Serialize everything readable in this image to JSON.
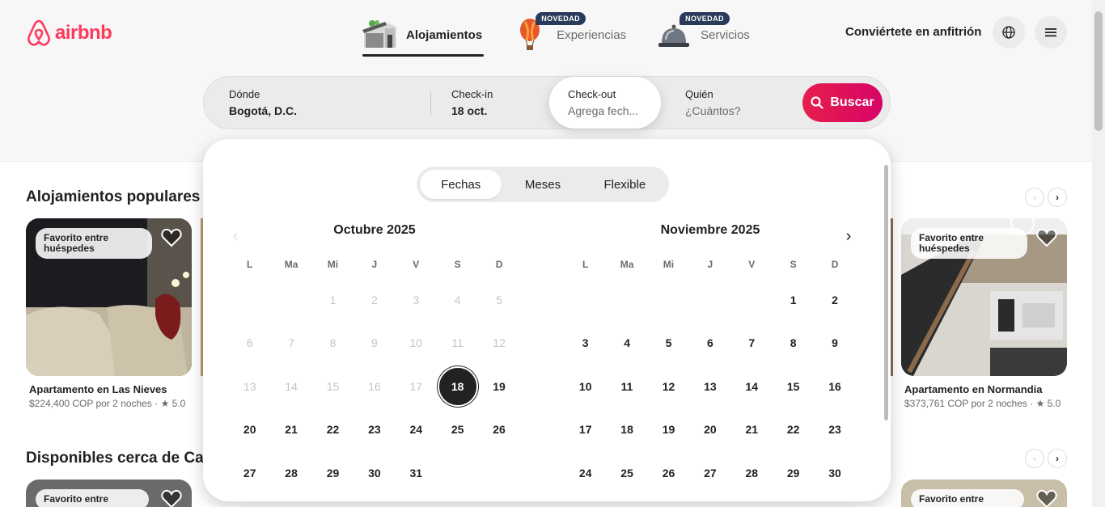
{
  "brand": {
    "name": "airbnb",
    "color": "#ff385c"
  },
  "nav": [
    {
      "label": "Alojamientos",
      "icon": "house-icon",
      "badge": ""
    },
    {
      "label": "Experiencias",
      "icon": "hot-air-balloon-icon",
      "badge": "NOVEDAD"
    },
    {
      "label": "Servicios",
      "icon": "service-bell-icon",
      "badge": "NOVEDAD"
    }
  ],
  "header": {
    "host_link": "Conviértete en anfitrión",
    "globe_icon": "globe-icon",
    "menu_icon": "menu-icon"
  },
  "search": {
    "where_label": "Dónde",
    "where_value": "Bogotá, D.C.",
    "checkin_label": "Check-in",
    "checkin_value": "18 oct.",
    "checkout_label": "Check-out",
    "checkout_placeholder": "Agrega fech...",
    "who_label": "Quién",
    "who_placeholder": "¿Cuántos?",
    "button_label": "Buscar"
  },
  "calendar": {
    "tabs": [
      "Fechas",
      "Meses",
      "Flexible"
    ],
    "active_tab": "Fechas",
    "weekdays": [
      "L",
      "Ma",
      "Mi",
      "J",
      "V",
      "S",
      "D"
    ],
    "months": [
      {
        "title": "Octubre 2025",
        "days": [
          "",
          "",
          "1",
          "2",
          "3",
          "4",
          "5",
          "6",
          "7",
          "8",
          "9",
          "10",
          "11",
          "12",
          "13",
          "14",
          "15",
          "16",
          "17",
          "18",
          "19",
          "20",
          "21",
          "22",
          "23",
          "24",
          "25",
          "26",
          "27",
          "28",
          "29",
          "30",
          "31"
        ],
        "past_until": 17,
        "selected": 18
      },
      {
        "title": "Noviembre 2025",
        "days": [
          "",
          "",
          "",
          "",
          "",
          "1",
          "2",
          "3",
          "4",
          "5",
          "6",
          "7",
          "8",
          "9",
          "10",
          "11",
          "12",
          "13",
          "14",
          "15",
          "16",
          "17",
          "18",
          "19",
          "20",
          "21",
          "22",
          "23",
          "24",
          "25",
          "26",
          "27",
          "28",
          "29",
          "30"
        ],
        "past_until": 0,
        "selected": 0
      }
    ]
  },
  "sections": [
    {
      "title": "Alojamientos populares en"
    },
    {
      "title": "Disponibles cerca de Carta"
    }
  ],
  "cards": [
    {
      "badge": "Favorito entre huéspedes",
      "title": "Apartamento en Las Nieves",
      "price": "$224,400 COP por 2 noches",
      "rating": "5.0"
    },
    {
      "badge": "Favorito entre huéspedes",
      "title": "Apartamento en Normandia",
      "price": "$373,761 COP por 2 noches",
      "rating": "5.0"
    }
  ],
  "bottom_cards": [
    {
      "badge": "Favorito entre"
    },
    {
      "badge": "Favorito entre"
    }
  ]
}
